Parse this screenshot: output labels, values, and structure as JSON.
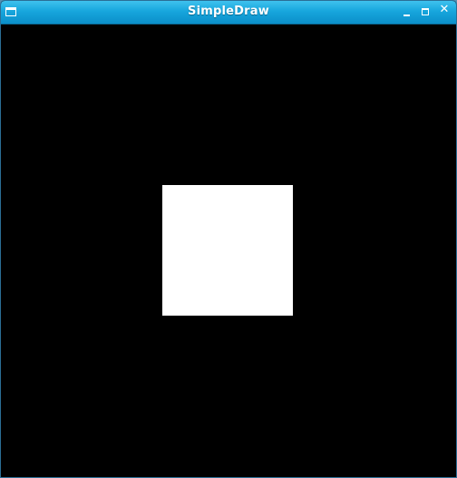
{
  "window": {
    "title": "SimpleDraw"
  },
  "titlebar": {
    "menu_icon": "window-menu-icon",
    "controls": {
      "minimize_icon": "minimize-icon",
      "maximize_icon": "maximize-icon",
      "close_icon": "close-icon",
      "close_glyph": "✕"
    }
  },
  "canvas": {
    "background_color": "#000000",
    "shape": {
      "type": "square",
      "color": "#ffffff"
    }
  },
  "colors": {
    "titlebar_accent": "#17a6dd",
    "title_text": "#ffffff"
  }
}
